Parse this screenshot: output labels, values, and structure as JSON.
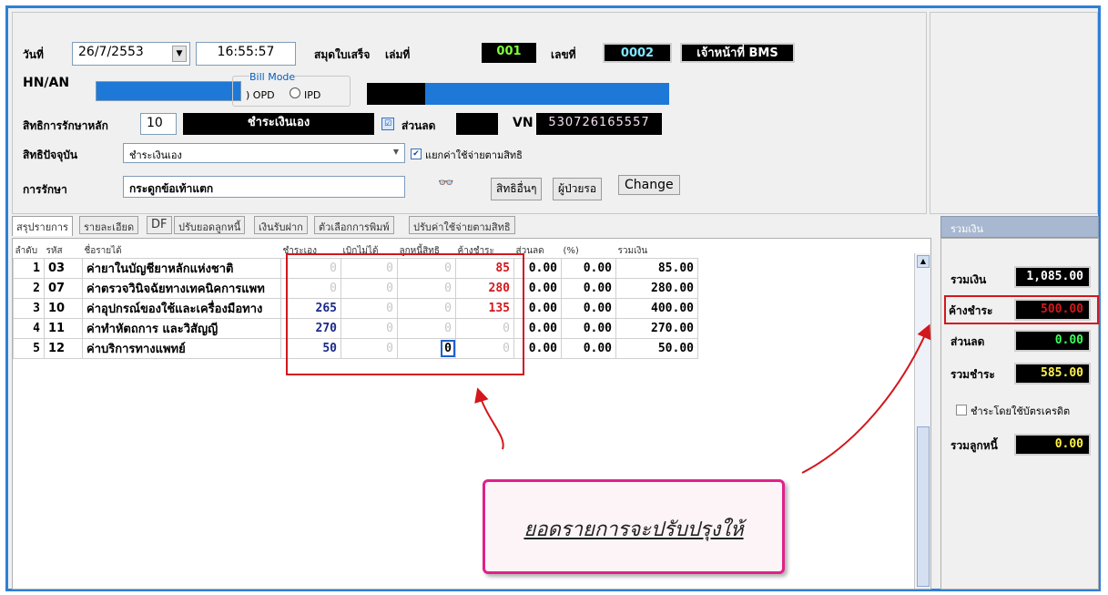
{
  "header": {
    "date_label": "วันที่",
    "date_value": "26/7/2553",
    "time_value": "16:55:57",
    "book_label": "สมุดใบเสร็จ",
    "volume_label": "เล่มที่",
    "volume_value": "001",
    "number_label": "เลขที่",
    "number_value": "0002",
    "officer": "เจ้าหน้าที่ BMS",
    "hn_label": "HN/AN",
    "bill_mode_label": "Bill Mode",
    "opd_label": "OPD",
    "ipd_label": "IPD",
    "main_right_label": "สิทธิการรักษาหลัก",
    "main_right_code": "10",
    "main_right_name": "ชำระเงินเอง",
    "discount_label": "ส่วนลด",
    "vn_label": "VN",
    "vn_value": "530726165557",
    "current_right_label": "สิทธิปัจจุบัน",
    "current_right_value": "ชำระเงินเอง",
    "separate_label": "แยกค่าใช้จ่ายตามสิทธิ",
    "treatment_label": "การรักษา",
    "treatment_value": "กระดูกข้อเท้าแตก",
    "btn_other": "สิทธิอื่นๆ",
    "btn_waiting": "ผู้ป่วยรอ",
    "btn_change": "Change"
  },
  "tabs": [
    "สรุปรายการ",
    "รายละเอียด",
    "DF",
    "ปรับยอดลูกหนี้",
    "เงินรับฝาก",
    "ตัวเลือกการพิมพ์",
    "ปรับค่าใช้จ่ายตามสิทธิ"
  ],
  "table": {
    "headers": [
      "ลำดับ",
      "รหัส",
      "ชื่อรายได้",
      "ชำระเอง",
      "เบิกไม่ได้",
      "ลูกหนี้สิทธิ",
      "ค้างชำระ",
      "ส่วนลด",
      "(%)",
      "รวมเงิน"
    ],
    "rows": [
      {
        "no": "1",
        "code": "03",
        "name": "ค่ายาในบัญชียาหลักแห่งชาติ",
        "self": "0",
        "nonclaim": "0",
        "debtor": "0",
        "outstanding": "85",
        "discount": "0.00",
        "pct": "0.00",
        "total": "85.00"
      },
      {
        "no": "2",
        "code": "07",
        "name": "ค่าตรวจวินิจฉัยทางเทคนิคการแพท",
        "self": "0",
        "nonclaim": "0",
        "debtor": "0",
        "outstanding": "280",
        "discount": "0.00",
        "pct": "0.00",
        "total": "280.00"
      },
      {
        "no": "3",
        "code": "10",
        "name": "ค่าอุปกรณ์ของใช้และเครื่องมือทาง",
        "self": "265",
        "nonclaim": "0",
        "debtor": "0",
        "outstanding": "135",
        "discount": "0.00",
        "pct": "0.00",
        "total": "400.00"
      },
      {
        "no": "4",
        "code": "11",
        "name": "ค่าทำหัตถการ และวิสัญญี",
        "self": "270",
        "nonclaim": "0",
        "debtor": "0",
        "outstanding": "0",
        "discount": "0.00",
        "pct": "0.00",
        "total": "270.00"
      },
      {
        "no": "5",
        "code": "12",
        "name": "ค่าบริการทางแพทย์",
        "self": "50",
        "nonclaim": "0",
        "debtor": "0",
        "outstanding": "0",
        "discount": "0.00",
        "pct": "0.00",
        "total": "50.00"
      }
    ]
  },
  "summary": {
    "panel_title": "รวมเงิน",
    "total_label": "รวมเงิน",
    "total_value": "1,085.00",
    "outstanding_label": "ค้างชำระ",
    "outstanding_value": "500.00",
    "discount_label": "ส่วนลด",
    "discount_value": "0.00",
    "paid_label": "รวมชำระ",
    "paid_value": "585.00",
    "credit_card_label": "ชำระโดยใช้บัตรเครดิต",
    "debtor_label": "รวมลูกหนี้",
    "debtor_value": "0.00"
  },
  "callout": {
    "text": "ยอดรายการจะปรับปรุงให้"
  },
  "colors": {
    "accent_border": "#2f7fd6",
    "highlight_red": "#d3171c",
    "callout_border": "#e0218a"
  }
}
